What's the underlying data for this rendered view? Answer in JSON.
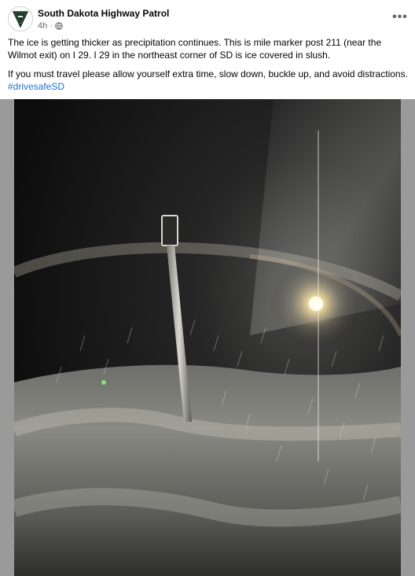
{
  "post": {
    "page_name": "South Dakota Highway Patrol",
    "timestamp": "4h",
    "separator": "·",
    "more_label": "•••",
    "paragraph_1": "The ice is getting thicker as precipitation continues. This is mile marker post 211 (near the Wilmot exit) on I 29. I 29 in the northeast corner of SD is ice covered in slush.",
    "paragraph_2": "If you must travel please allow yourself extra time, slow down, buckle up, and avoid distractions.",
    "hashtag": "#drivesafeSD"
  },
  "icons": {
    "avatar": "highway-patrol-badge-logo",
    "audience": "globe-icon",
    "more": "more-options-icon"
  },
  "colors": {
    "link": "#216fdb",
    "meta": "#65676b",
    "badge_green": "#1f6b3a"
  }
}
